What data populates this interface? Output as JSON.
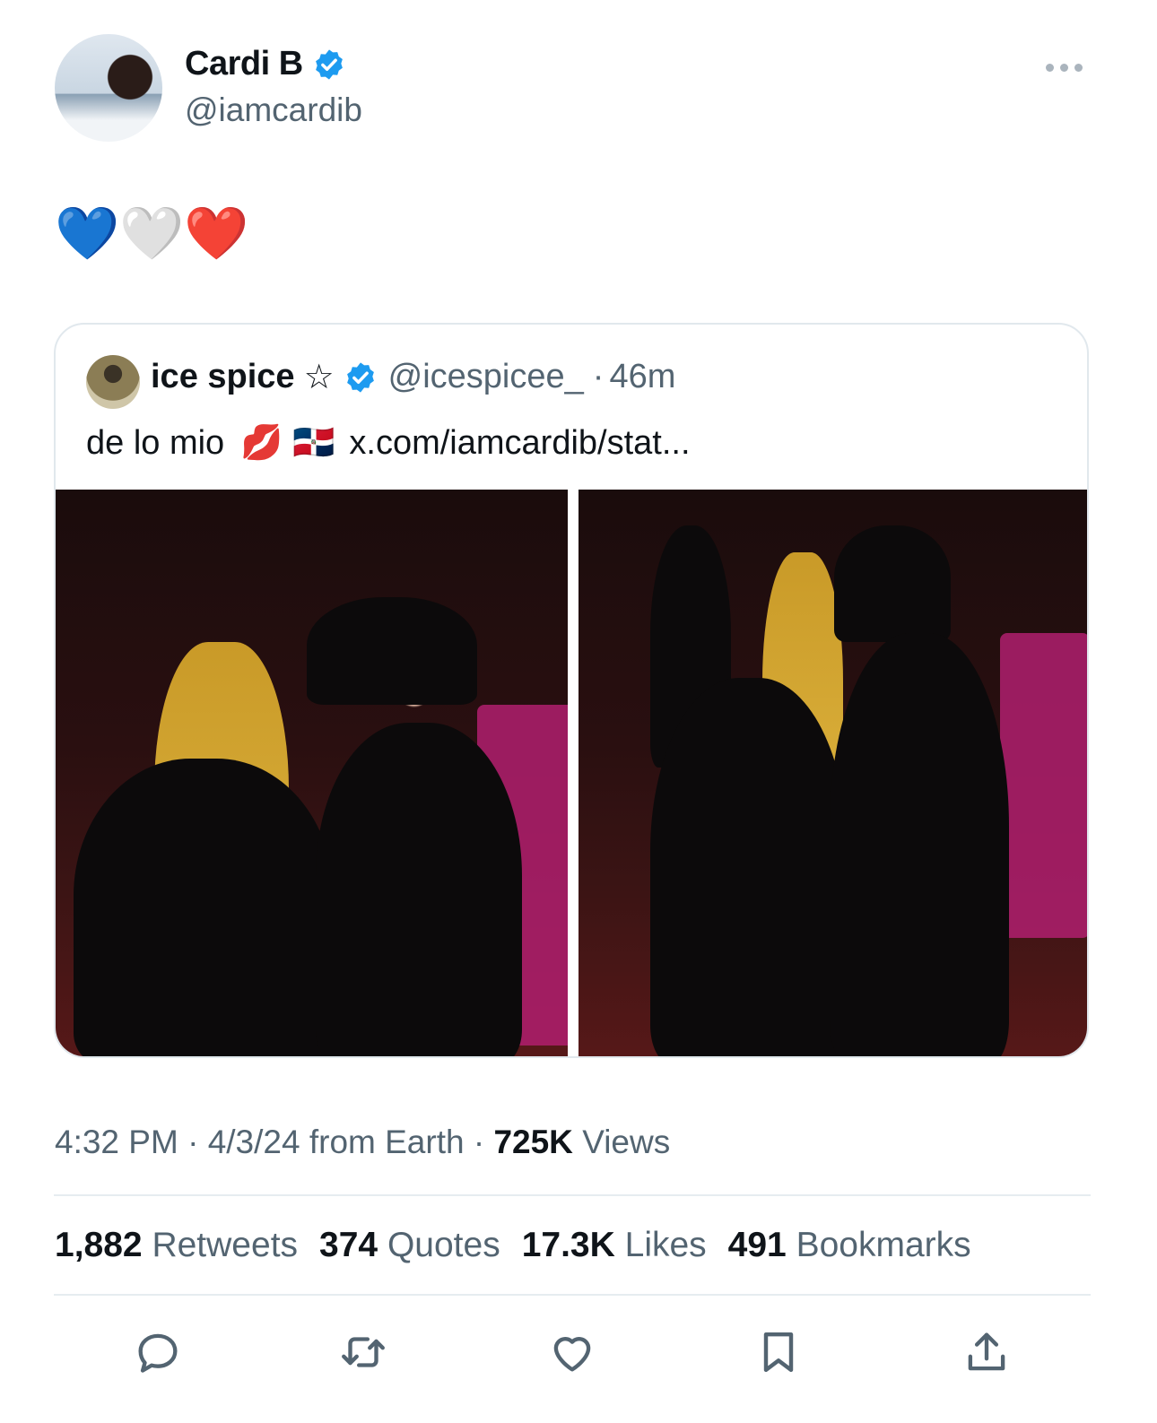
{
  "author": {
    "name": "Cardi B",
    "handle": "@iamcardib",
    "verified_color": "#1d9bf0"
  },
  "tweet": {
    "text": "💙🤍❤️"
  },
  "quoted": {
    "name": "ice spice",
    "name_suffix": "☆",
    "handle": "@icespicee_",
    "separator": "·",
    "time": "46m",
    "text": "de lo mio",
    "emoji": "💋 🇩🇴",
    "link": "x.com/iamcardib/stat..."
  },
  "meta": {
    "time": "4:32 PM",
    "sep1": "·",
    "date_origin": "4/3/24 from Earth",
    "sep2": "·",
    "views_count": "725K",
    "views_label": "Views"
  },
  "stats": [
    {
      "count": "1,882",
      "label": "Retweets"
    },
    {
      "count": "374",
      "label": "Quotes"
    },
    {
      "count": "17.3K",
      "label": "Likes"
    },
    {
      "count": "491",
      "label": "Bookmarks"
    }
  ],
  "actions": [
    "reply-icon",
    "retweet-icon",
    "like-icon",
    "bookmark-icon",
    "share-icon"
  ],
  "colors": {
    "text_primary": "#0f1419",
    "text_secondary": "#536471",
    "accent": "#1d9bf0"
  }
}
